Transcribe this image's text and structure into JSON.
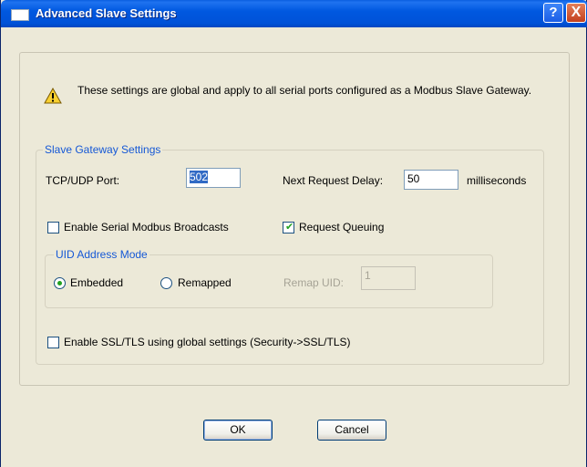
{
  "window": {
    "title": "Advanced Slave Settings",
    "help_glyph": "?",
    "close_glyph": "X"
  },
  "info": {
    "text": "These settings are global and apply to all serial ports configured as a Modbus Slave Gateway."
  },
  "slave_gateway": {
    "legend": "Slave Gateway Settings",
    "tcp_udp_port_label": "TCP/UDP Port:",
    "tcp_udp_port_value": "502",
    "next_request_delay_label": "Next Request Delay:",
    "next_request_delay_value": "50",
    "milliseconds_label": "milliseconds",
    "enable_broadcasts_label": "Enable Serial Modbus Broadcasts",
    "enable_broadcasts_checked": false,
    "request_queuing_label": "Request Queuing",
    "request_queuing_checked": true,
    "uid_mode": {
      "legend": "UID Address Mode",
      "embedded_label": "Embedded",
      "embedded_selected": true,
      "remapped_label": "Remapped",
      "remapped_selected": false,
      "remap_uid_label": "Remap UID:",
      "remap_uid_value": "1"
    },
    "ssl_label": "Enable SSL/TLS using global settings (Security->SSL/TLS)",
    "ssl_checked": false
  },
  "buttons": {
    "ok": "OK",
    "cancel": "Cancel"
  },
  "colors": {
    "titlebar": "#0058e0",
    "legend_text": "#1558d6",
    "check_mark": "#21a121",
    "dialog_bg": "#ece9d8"
  },
  "icons": {
    "warning": "warning-icon",
    "check": "check-icon"
  }
}
